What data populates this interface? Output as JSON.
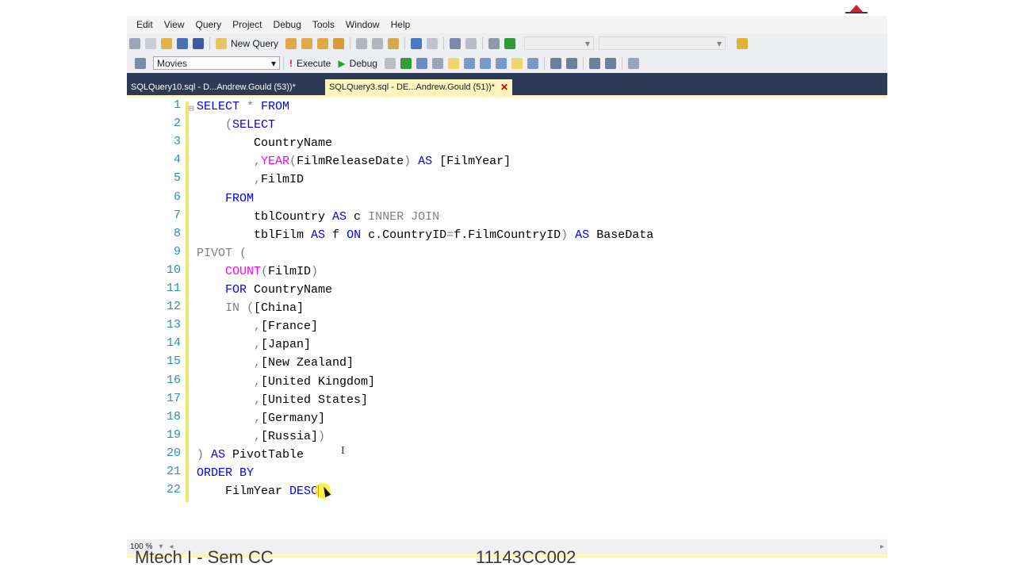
{
  "menu": [
    "Edit",
    "View",
    "Query",
    "Project",
    "Debug",
    "Tools",
    "Window",
    "Help"
  ],
  "toolbar": {
    "new_query_label": "New Query",
    "database_combo": "Movies",
    "execute_label": "Execute",
    "debug_label": "Debug"
  },
  "tabs": [
    {
      "label": "SQLQuery10.sql - D...Andrew.Gould (53))*",
      "active": false
    },
    {
      "label": "SQLQuery3.sql - DE...Andrew.Gould (51))*",
      "active": true
    }
  ],
  "editor": {
    "line_numbers": [
      "1",
      "2",
      "3",
      "4",
      "5",
      "6",
      "7",
      "8",
      "9",
      "10",
      "11",
      "12",
      "13",
      "14",
      "15",
      "16",
      "17",
      "18",
      "19",
      "20",
      "21",
      "22"
    ],
    "lines": [
      [
        {
          "t": "SELECT",
          "c": "kw"
        },
        {
          "t": " ",
          "c": ""
        },
        {
          "t": "*",
          "c": "gr"
        },
        {
          "t": " FROM",
          "c": "kw"
        }
      ],
      [
        {
          "t": "    ",
          "c": ""
        },
        {
          "t": "(",
          "c": "gr"
        },
        {
          "t": "SELECT",
          "c": "kw"
        }
      ],
      [
        {
          "t": "        CountryName",
          "c": ""
        }
      ],
      [
        {
          "t": "        ",
          "c": ""
        },
        {
          "t": ",",
          "c": "gr"
        },
        {
          "t": "YEAR",
          "c": "fn"
        },
        {
          "t": "(",
          "c": "gr"
        },
        {
          "t": "FilmReleaseDate",
          "c": ""
        },
        {
          "t": ")",
          "c": "gr"
        },
        {
          "t": " AS ",
          "c": "kw"
        },
        {
          "t": "[FilmYear]",
          "c": ""
        }
      ],
      [
        {
          "t": "        ",
          "c": ""
        },
        {
          "t": ",",
          "c": "gr"
        },
        {
          "t": "FilmID",
          "c": ""
        }
      ],
      [
        {
          "t": "    ",
          "c": ""
        },
        {
          "t": "FROM",
          "c": "kw"
        }
      ],
      [
        {
          "t": "        tblCountry ",
          "c": ""
        },
        {
          "t": "AS",
          "c": "kw"
        },
        {
          "t": " c ",
          "c": ""
        },
        {
          "t": "INNER JOIN",
          "c": "gr"
        }
      ],
      [
        {
          "t": "        tblFilm ",
          "c": ""
        },
        {
          "t": "AS",
          "c": "kw"
        },
        {
          "t": " f ",
          "c": ""
        },
        {
          "t": "ON",
          "c": "kw"
        },
        {
          "t": " c.CountryID",
          "c": ""
        },
        {
          "t": "=",
          "c": "gr"
        },
        {
          "t": "f.FilmCountryID",
          "c": ""
        },
        {
          "t": ")",
          "c": "gr"
        },
        {
          "t": " AS",
          "c": "kw"
        },
        {
          "t": " BaseData",
          "c": ""
        }
      ],
      [
        {
          "t": "PIVOT (",
          "c": "gr"
        }
      ],
      [
        {
          "t": "    ",
          "c": ""
        },
        {
          "t": "COUNT",
          "c": "fn"
        },
        {
          "t": "(",
          "c": "gr"
        },
        {
          "t": "FilmID",
          "c": ""
        },
        {
          "t": ")",
          "c": "gr"
        }
      ],
      [
        {
          "t": "    ",
          "c": ""
        },
        {
          "t": "FOR",
          "c": "kw"
        },
        {
          "t": " CountryName",
          "c": ""
        }
      ],
      [
        {
          "t": "    ",
          "c": ""
        },
        {
          "t": "IN (",
          "c": "gr"
        },
        {
          "t": "[China]",
          "c": ""
        }
      ],
      [
        {
          "t": "        ",
          "c": ""
        },
        {
          "t": ",",
          "c": "gr"
        },
        {
          "t": "[France]",
          "c": ""
        }
      ],
      [
        {
          "t": "        ",
          "c": ""
        },
        {
          "t": ",",
          "c": "gr"
        },
        {
          "t": "[Japan]",
          "c": ""
        }
      ],
      [
        {
          "t": "        ",
          "c": ""
        },
        {
          "t": ",",
          "c": "gr"
        },
        {
          "t": "[New Zealand]",
          "c": ""
        }
      ],
      [
        {
          "t": "        ",
          "c": ""
        },
        {
          "t": ",",
          "c": "gr"
        },
        {
          "t": "[United Kingdom]",
          "c": ""
        }
      ],
      [
        {
          "t": "        ",
          "c": ""
        },
        {
          "t": ",",
          "c": "gr"
        },
        {
          "t": "[United States]",
          "c": ""
        }
      ],
      [
        {
          "t": "        ",
          "c": ""
        },
        {
          "t": ",",
          "c": "gr"
        },
        {
          "t": "[Germany]",
          "c": ""
        }
      ],
      [
        {
          "t": "        ",
          "c": ""
        },
        {
          "t": ",",
          "c": "gr"
        },
        {
          "t": "[Russia]",
          "c": ""
        },
        {
          "t": ")",
          "c": "gr"
        }
      ],
      [
        {
          "t": ")",
          "c": "gr"
        },
        {
          "t": " AS",
          "c": "kw"
        },
        {
          "t": " PivotTable",
          "c": ""
        }
      ],
      [
        {
          "t": "ORDER BY",
          "c": "kw"
        }
      ],
      [
        {
          "t": "    FilmYear ",
          "c": ""
        },
        {
          "t": "DESC",
          "c": "kw"
        }
      ]
    ]
  },
  "status": {
    "zoom": "100 %"
  },
  "caption": {
    "left": "Mtech I - Sem CC",
    "right": "11143CC002"
  },
  "colors": {
    "keyword": "#0000ff",
    "operator": "#808080",
    "function": "#ff00ff",
    "line_number": "#2b91af",
    "tab_bg": "#2d3a55",
    "active_tab": "#fdf4bf"
  }
}
